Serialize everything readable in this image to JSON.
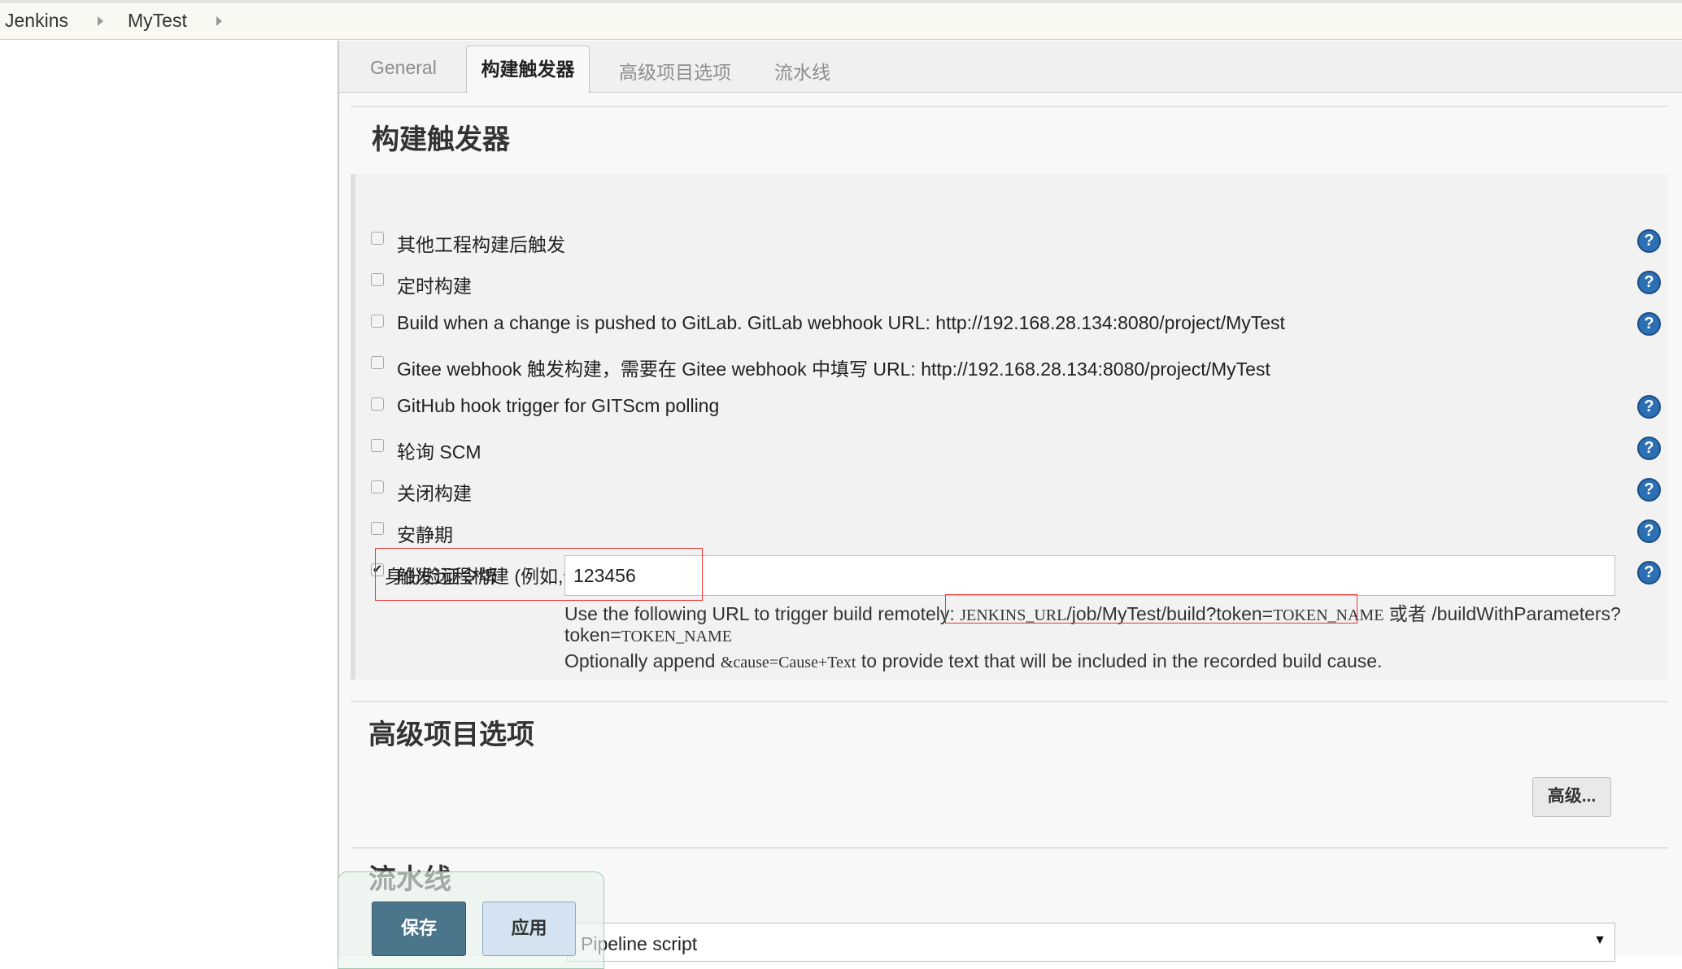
{
  "breadcrumb": {
    "items": [
      "Jenkins",
      "MyTest"
    ]
  },
  "tabs": [
    "General",
    "构建触发器",
    "高级项目选项",
    "流水线"
  ],
  "active_tab": "构建触发器",
  "sections": {
    "triggers_title": "构建触发器",
    "advanced_title": "高级项目选项",
    "pipeline_title": "流水线"
  },
  "triggers": [
    {
      "label": "其他工程构建后触发",
      "checked": false,
      "help": true
    },
    {
      "label": "定时构建",
      "checked": false,
      "help": true
    },
    {
      "label": "Build when a change is pushed to GitLab. GitLab webhook URL: http://192.168.28.134:8080/project/MyTest",
      "checked": false,
      "help": true
    },
    {
      "label": "Gitee webhook 触发构建，需要在 Gitee webhook 中填写 URL: http://192.168.28.134:8080/project/MyTest",
      "checked": false,
      "help": false
    },
    {
      "label": "GitHub hook trigger for GITScm polling",
      "checked": false,
      "help": true
    },
    {
      "label": "轮询 SCM",
      "checked": false,
      "help": true
    },
    {
      "label": "关闭构建",
      "checked": false,
      "help": true
    },
    {
      "label": "安静期",
      "checked": false,
      "help": true
    },
    {
      "label": "触发远程构建 (例如,使用脚本)",
      "checked": true,
      "help": true
    }
  ],
  "token": {
    "label": "身份验证令牌",
    "value": "123456"
  },
  "remote_info": {
    "line1_pre": "Use the following URL to trigger build remotely: ",
    "url_var": "JENKINS_URL",
    "url_path": "/job/MyTest/build?token=",
    "token_var": "TOKEN_NAME",
    "line1_or": " 或者 /buildWithParameters?",
    "line2_pre": "token=",
    "line2_var": "TOKEN_NAME",
    "line3_pre": "Optionally append ",
    "line3_code": "&cause=Cause+Text",
    "line3_post": " to provide text that will be included in the recorded build cause."
  },
  "advanced_button": "高级...",
  "pipeline_definition": "Pipeline script",
  "buttons": {
    "save": "保存",
    "apply": "应用"
  },
  "colors": {
    "save_button": "#4b758b",
    "apply_button": "#d3e3f1",
    "help_icon": "#2d6fb3",
    "highlight_box": "#ee3333"
  },
  "icons": {
    "help": "help-icon",
    "breadcrumb_separator": "chevron-right-icon",
    "select_arrow": "chevron-down-icon"
  }
}
